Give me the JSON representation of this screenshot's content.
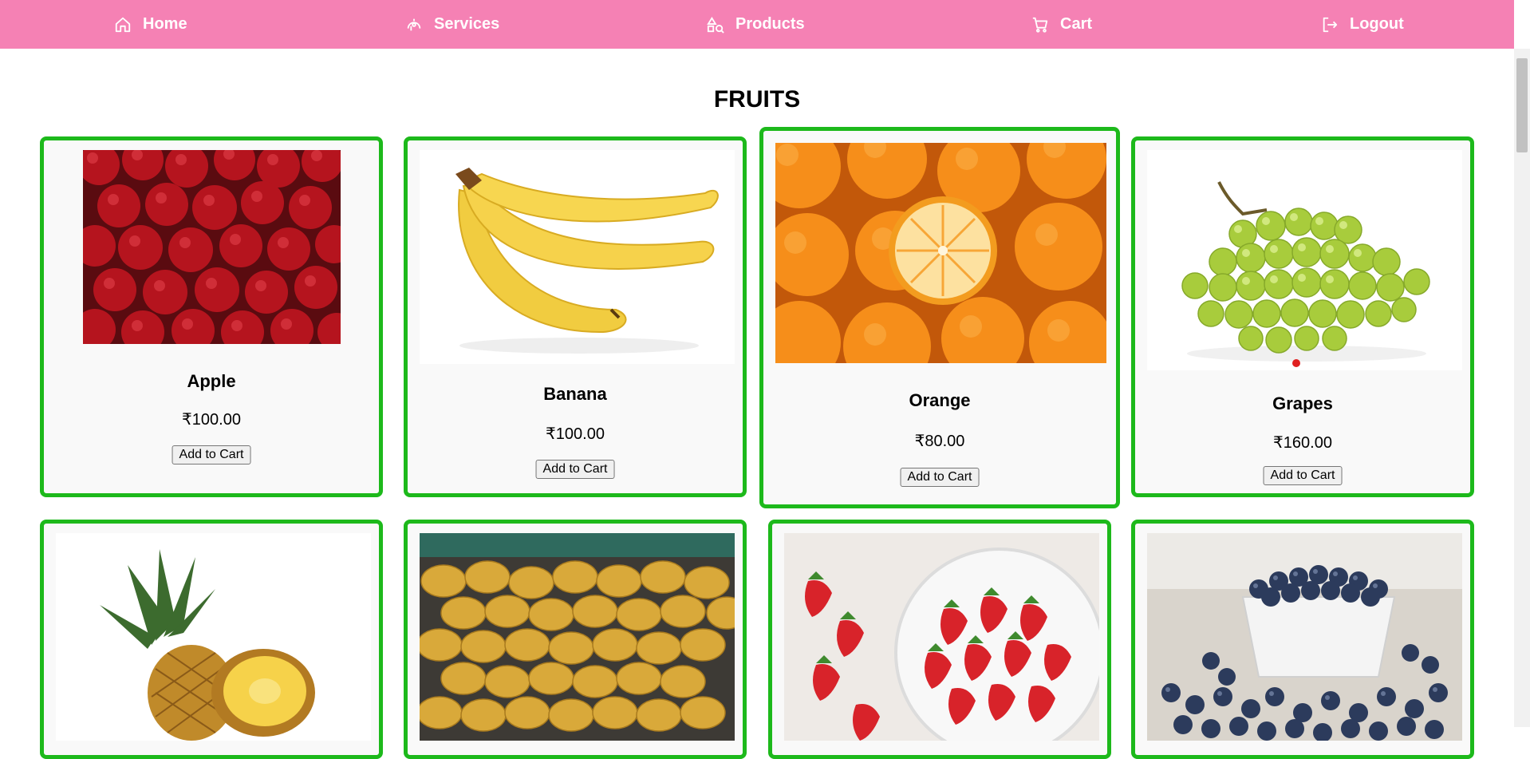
{
  "nav": {
    "items": [
      {
        "label": "Home",
        "icon": "home-icon"
      },
      {
        "label": "Services",
        "icon": "services-icon"
      },
      {
        "label": "Products",
        "icon": "products-icon"
      },
      {
        "label": "Cart",
        "icon": "cart-icon"
      },
      {
        "label": "Logout",
        "icon": "logout-icon"
      }
    ]
  },
  "section": {
    "title": "FRUITS"
  },
  "products": [
    {
      "name": "Apple",
      "price": "₹100.00",
      "button": "Add to Cart"
    },
    {
      "name": "Banana",
      "price": "₹100.00",
      "button": "Add to Cart"
    },
    {
      "name": "Orange",
      "price": "₹80.00",
      "button": "Add to Cart"
    },
    {
      "name": "Grapes",
      "price": "₹160.00",
      "button": "Add to Cart"
    }
  ],
  "colors": {
    "nav_bg": "#f581b4",
    "card_border": "#1db91b"
  }
}
